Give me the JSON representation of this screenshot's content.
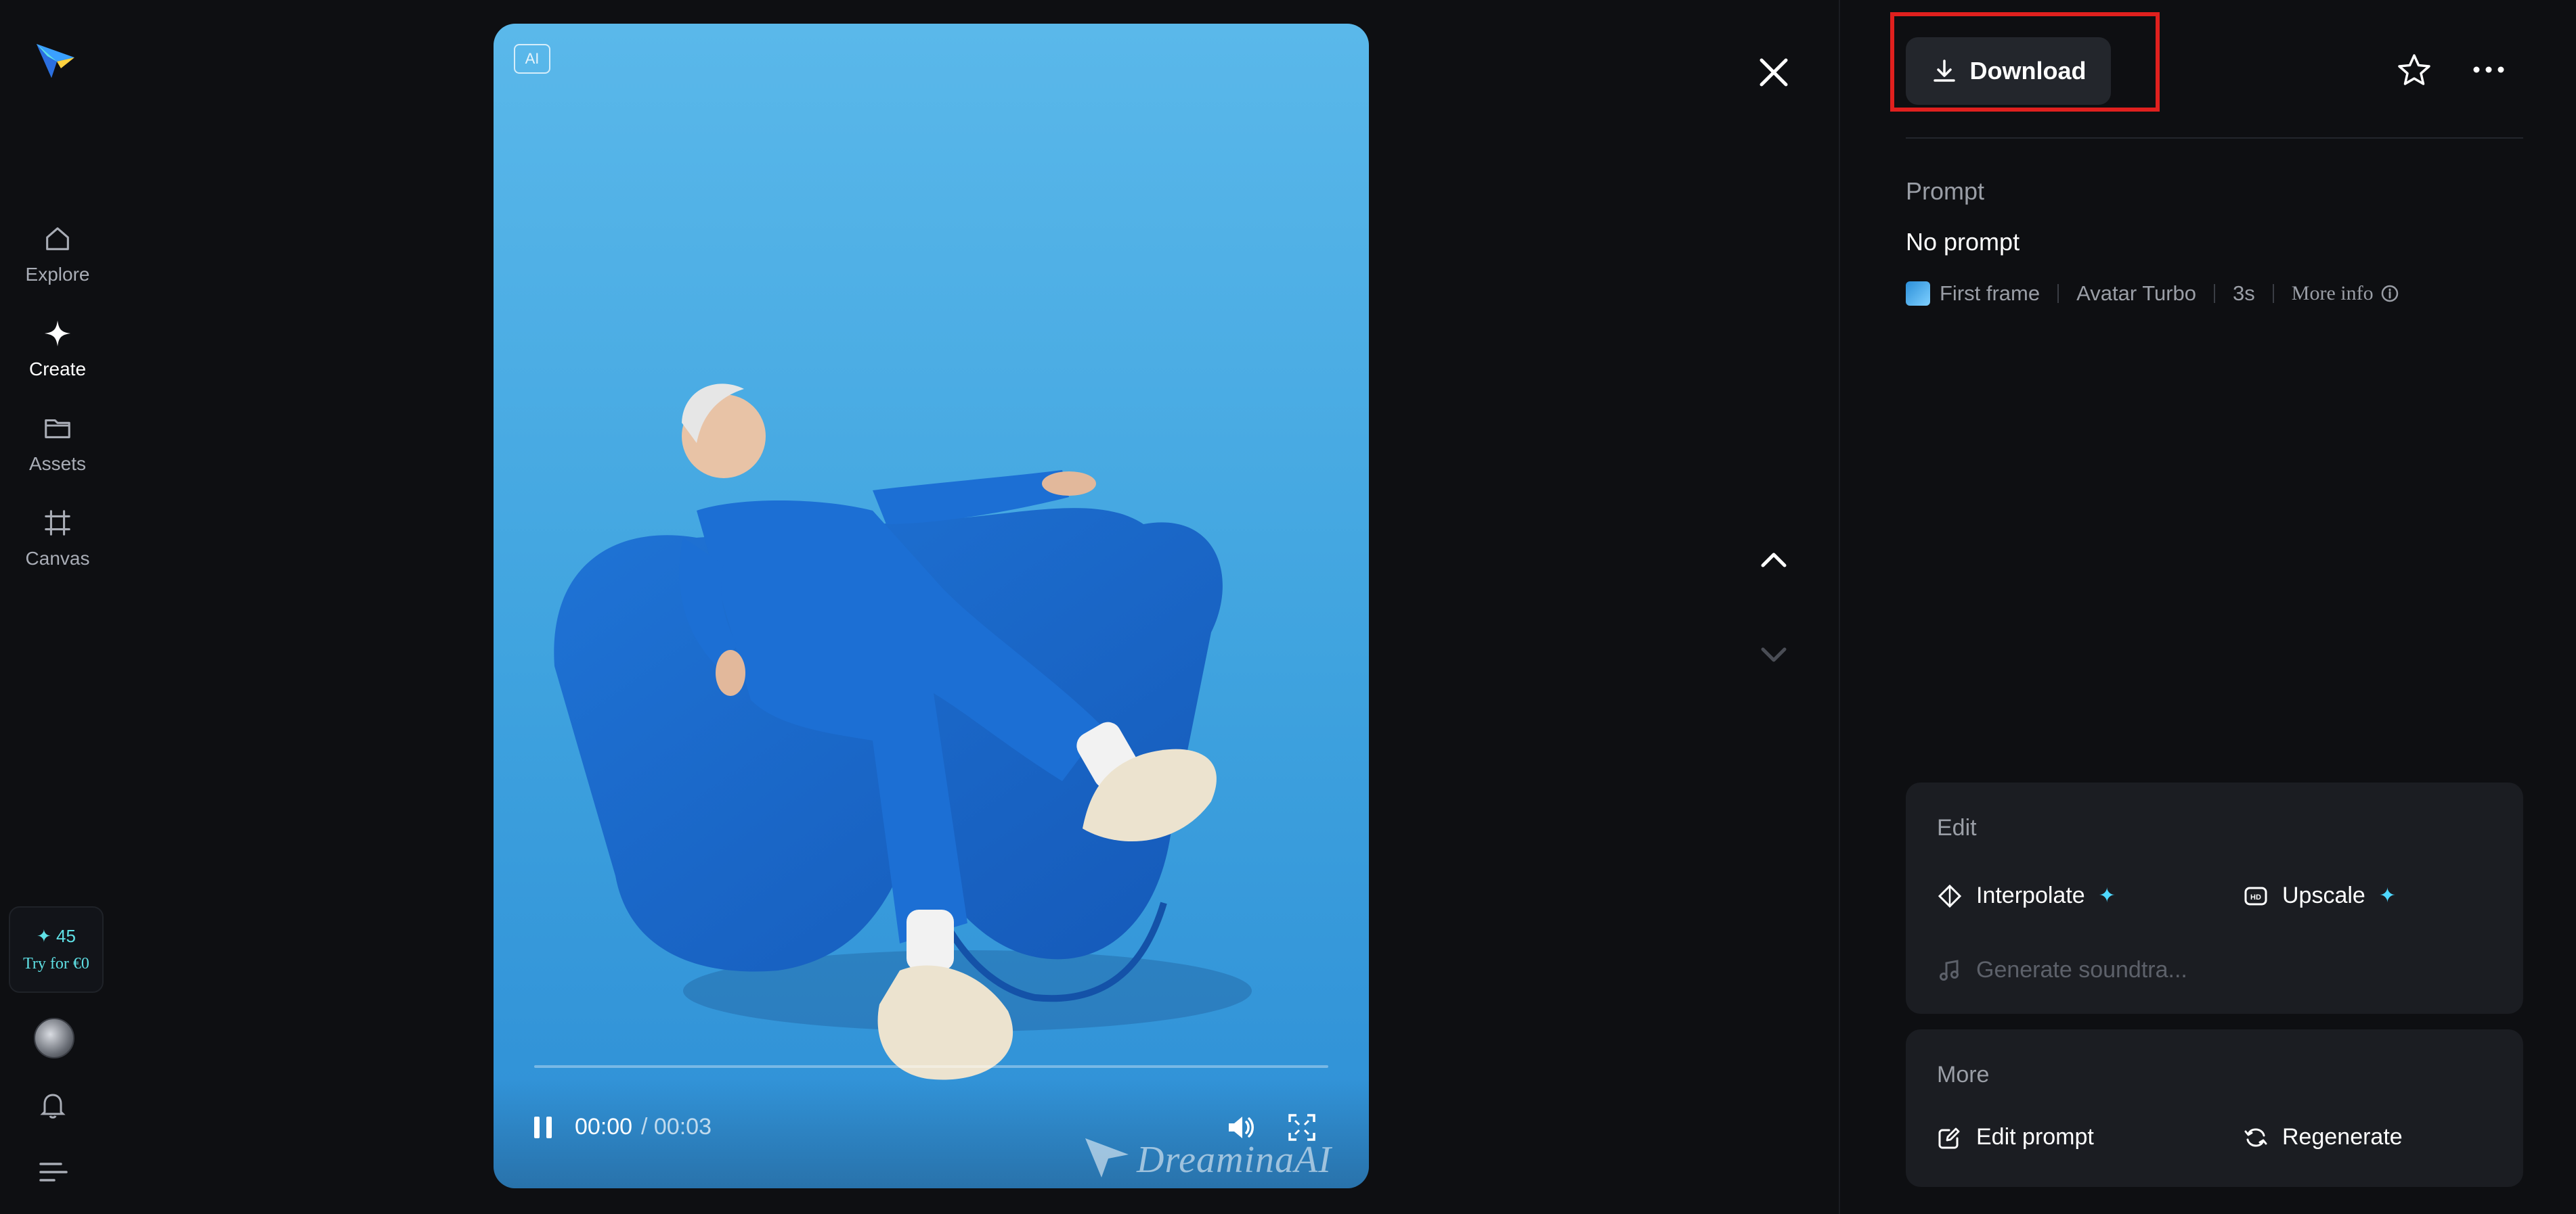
{
  "sidebar": {
    "items": [
      {
        "label": "Explore",
        "icon": "home-icon"
      },
      {
        "label": "Create",
        "icon": "sparkle-icon",
        "active": true
      },
      {
        "label": "Assets",
        "icon": "folder-icon"
      },
      {
        "label": "Canvas",
        "icon": "canvas-frame-icon"
      }
    ],
    "credits": {
      "count": "✦ 45",
      "cta": "Try for €0"
    }
  },
  "video": {
    "badge": "AI",
    "time_current": "00:00",
    "time_total": "/ 00:03",
    "progress": 0.0,
    "watermark": "DreaminaAI"
  },
  "panel": {
    "download_label": "Download",
    "prompt_heading": "Prompt",
    "prompt_text": "No prompt",
    "meta": {
      "first_frame": "First frame",
      "model": "Avatar Turbo",
      "duration": "3s",
      "more_info": "More info"
    },
    "edit": {
      "heading": "Edit",
      "interpolate": "Interpolate",
      "upscale": "Upscale",
      "soundtrack": "Generate soundtra..."
    },
    "more": {
      "heading": "More",
      "edit_prompt": "Edit prompt",
      "regenerate": "Regenerate"
    }
  },
  "colors": {
    "background": "#0e0f12",
    "card": "#1b1d22",
    "accent_cyan": "#4fd8ff",
    "highlight_red": "#e0201e"
  }
}
